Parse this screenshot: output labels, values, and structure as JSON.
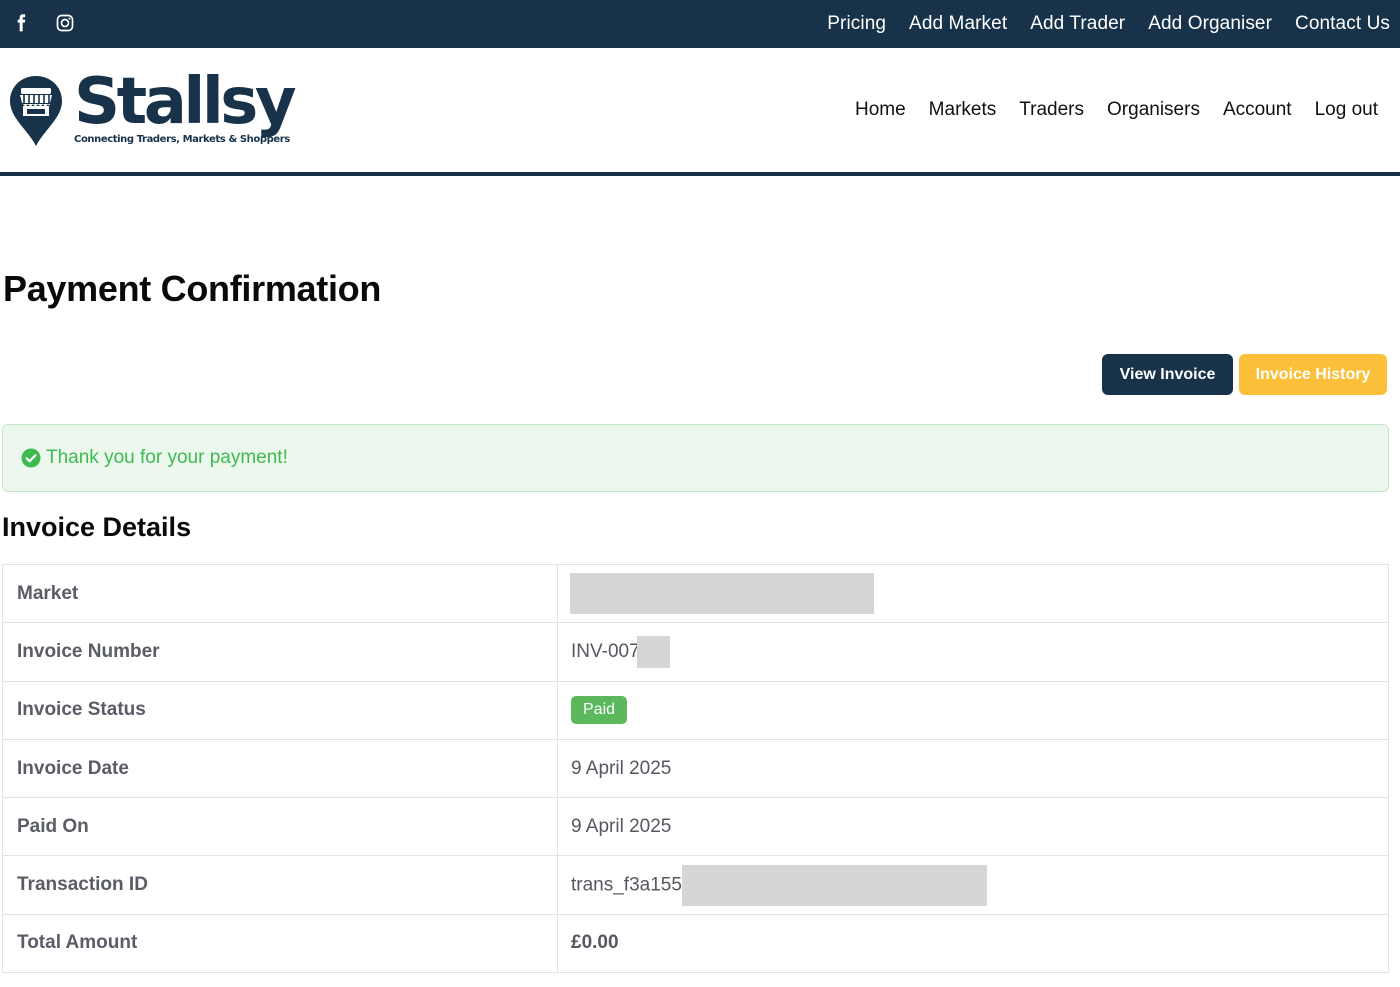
{
  "topbar": {
    "social": [
      {
        "icon": "facebook-icon"
      },
      {
        "icon": "instagram-icon"
      }
    ],
    "links": [
      "Pricing",
      "Add Market",
      "Add Trader",
      "Add Organiser",
      "Contact Us"
    ]
  },
  "brand": {
    "name": "Stallsy",
    "tagline": "Connecting Traders, Markets & Shoppers",
    "color": "#18324a"
  },
  "mainnav": [
    "Home",
    "Markets",
    "Traders",
    "Organisers",
    "Account",
    "Log out"
  ],
  "page": {
    "title": "Payment Confirmation",
    "view_invoice_label": "View Invoice",
    "invoice_history_label": "Invoice History",
    "alert_text": "Thank you for your payment!",
    "section_title": "Invoice Details"
  },
  "details": {
    "market": {
      "label": "Market",
      "value": ""
    },
    "invoice_number": {
      "label": "Invoice Number",
      "value": "INV-007("
    },
    "invoice_status": {
      "label": "Invoice Status",
      "value": "Paid"
    },
    "invoice_date": {
      "label": "Invoice Date",
      "value": "9 April 2025"
    },
    "paid_on": {
      "label": "Paid On",
      "value": "9 April 2025"
    },
    "transaction_id": {
      "label": "Transaction ID",
      "value": "trans_f3a155i"
    },
    "total_amount": {
      "label": "Total Amount",
      "value": "£0.00"
    }
  },
  "colors": {
    "navy": "#18324a",
    "yellow": "#fbbf3a",
    "success": "#3fb950",
    "badge_green": "#5cb85c"
  }
}
